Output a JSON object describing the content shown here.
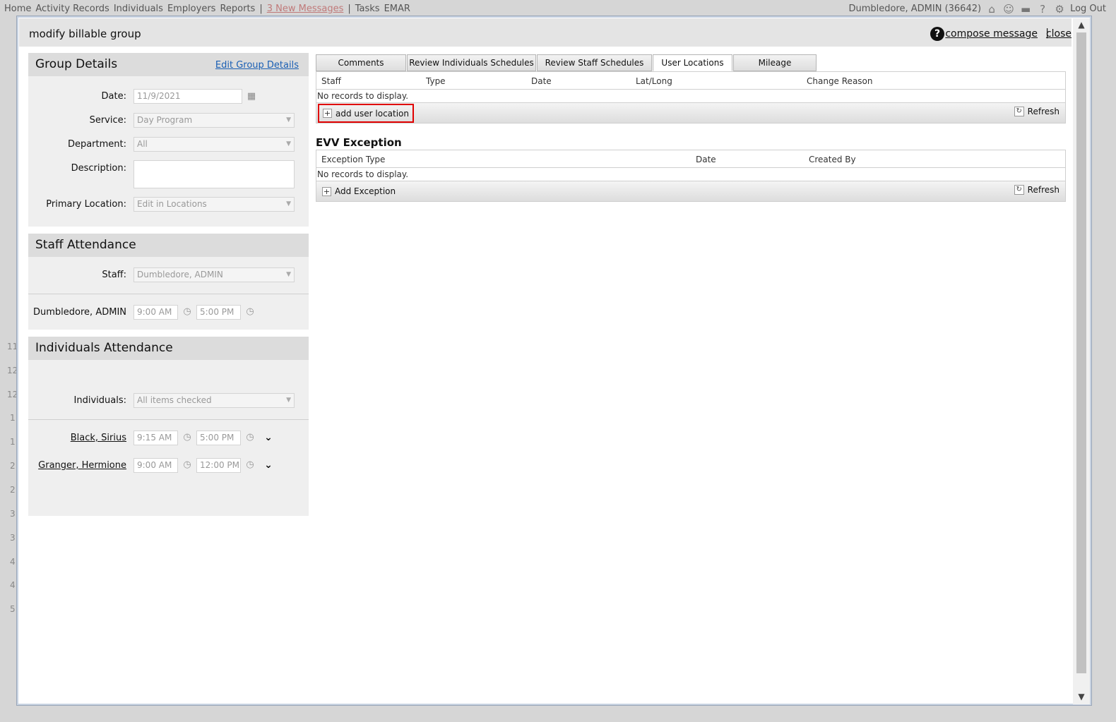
{
  "background": {
    "nav": [
      "Home",
      "Activity Records",
      "Individuals",
      "Employers",
      "Reports",
      "|",
      "3 New Messages",
      "|",
      "Tasks",
      "EMAR"
    ],
    "user": "Dumbledore, ADMIN (36642)",
    "logout": "Log Out",
    "stub_rows": [
      "11",
      "12",
      "12",
      "1",
      "1",
      "2",
      "2",
      "3",
      "3",
      "4",
      "4",
      "5"
    ]
  },
  "modal": {
    "title": "modify billable group",
    "compose_label": "compose message",
    "separator": "|",
    "close_label": "close"
  },
  "group_details": {
    "heading": "Group Details",
    "edit_link": "Edit Group Details",
    "date_label": "Date:",
    "date_value": "11/9/2021",
    "service_label": "Service:",
    "service_value": "Day Program",
    "department_label": "Department:",
    "department_value": "All",
    "description_label": "Description:",
    "description_value": "",
    "primary_location_label": "Primary Location:",
    "primary_location_value": "Edit in Locations"
  },
  "staff_attendance": {
    "heading": "Staff Attendance",
    "staff_label": "Staff:",
    "staff_value": "Dumbledore, ADMIN",
    "rows": [
      {
        "name": "Dumbledore, ADMIN",
        "start": "9:00 AM",
        "end": "5:00 PM"
      }
    ]
  },
  "individuals_attendance": {
    "heading": "Individuals Attendance",
    "individuals_label": "Individuals:",
    "individuals_value": "All items checked",
    "rows": [
      {
        "name": "Black, Sirius",
        "start": "9:15 AM",
        "end": "5:00 PM"
      },
      {
        "name": "Granger, Hermione",
        "start": "9:00 AM",
        "end": "12:00 PM"
      }
    ]
  },
  "tabs": [
    "Comments",
    "Review Individuals Schedules",
    "Review Staff Schedules",
    "User Locations",
    "Mileage"
  ],
  "active_tab": "User Locations",
  "user_locations_grid": {
    "columns": [
      "Staff",
      "Type",
      "Date",
      "Lat/Long",
      "Change Reason"
    ],
    "empty_text": "No records to display.",
    "add_label": "add user location",
    "refresh_label": "Refresh"
  },
  "evv_exception": {
    "title": "EVV Exception",
    "columns": [
      "Exception Type",
      "Date",
      "Created By"
    ],
    "empty_text": "No records to display.",
    "add_label": "Add Exception",
    "refresh_label": "Refresh"
  },
  "colors": {
    "highlight": "#e00000",
    "link": "#1a5fb4",
    "panel": "#efefef",
    "panel_header": "#dcdcdc"
  }
}
